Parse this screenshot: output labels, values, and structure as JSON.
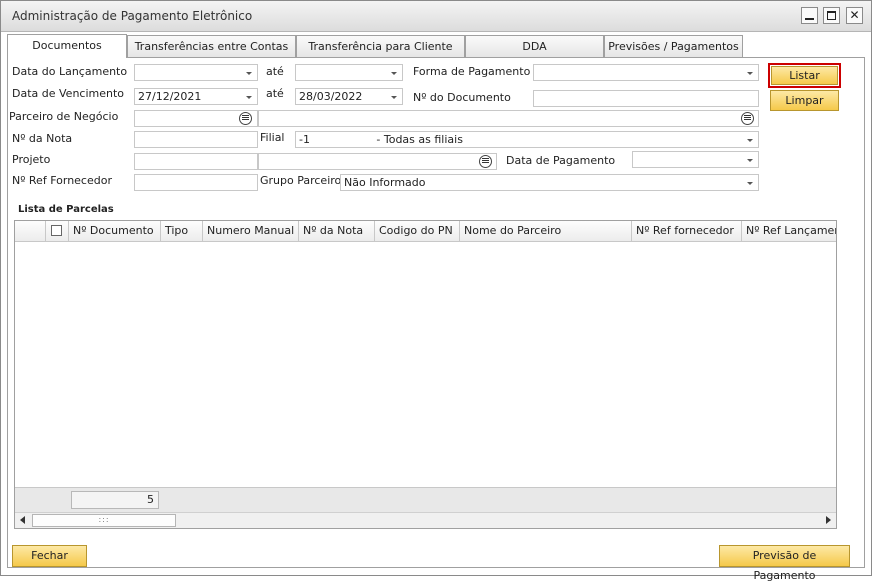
{
  "window": {
    "title": "Administração de Pagamento Eletrônico"
  },
  "tabs": [
    {
      "label": "Documentos",
      "active": true
    },
    {
      "label": "Transferências entre Contas"
    },
    {
      "label": "Transferência para Cliente"
    },
    {
      "label": "DDA"
    },
    {
      "label": "Previsões / Pagamentos"
    }
  ],
  "form": {
    "data_lancamento": {
      "label": "Data do Lançamento",
      "value": "",
      "ate_label": "até",
      "ate_value": ""
    },
    "data_vencimento": {
      "label": "Data de Vencimento",
      "value": "27/12/2021",
      "ate_label": "até",
      "ate_value": "28/03/2022"
    },
    "forma_pagamento": {
      "label": "Forma de Pagamento",
      "value": ""
    },
    "numero_documento": {
      "label": "Nº do Documento",
      "value": ""
    },
    "parceiro_negocio": {
      "label": "Parceiro de Negócio",
      "code": "",
      "name": ""
    },
    "numero_nota": {
      "label": "Nº da Nota",
      "value": ""
    },
    "filial": {
      "label": "Filial",
      "value": "-1                   - Todas as filiais"
    },
    "projeto": {
      "label": "Projeto",
      "code": "",
      "name": ""
    },
    "data_pagamento": {
      "label": "Data de Pagamento",
      "value": ""
    },
    "ref_fornecedor": {
      "label": "Nº Ref Fornecedor",
      "value": ""
    },
    "grupo_parceiro": {
      "label": "Grupo Parceiro",
      "value": "Não Informado"
    }
  },
  "buttons": {
    "listar": "Listar",
    "limpar": "Limpar",
    "fechar": "Fechar",
    "previsao": "Previsão de Pagamento"
  },
  "grid": {
    "title": "Lista de Parcelas",
    "columns": [
      "Nº Documento",
      "Tipo",
      "Numero Manual",
      "Nº da Nota",
      "Codigo do PN",
      "Nome do Parceiro",
      "Nº Ref fornecedor",
      "Nº Ref Lançamento"
    ],
    "count": "5",
    "thumb_grip": ":::"
  },
  "colors": {
    "accent_button": "#f5c94a",
    "focus_border": "#cc0000"
  }
}
